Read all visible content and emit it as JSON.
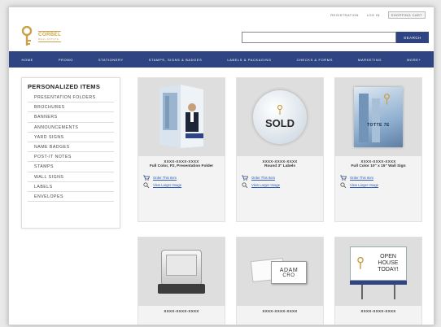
{
  "header": {
    "links": [
      "REGISTRATION",
      "LOG IN",
      "SHOPPING CART"
    ],
    "brand": "CORBEL",
    "brand_sub": "REAL ESTATE",
    "search": {
      "placeholder": "",
      "button": "SEARCH"
    }
  },
  "nav": [
    "HOME",
    "PROMO",
    "STATIONERY",
    "STAMPS, SIGNS & BADGES",
    "LABELS & PACKAGING",
    "CHECKS & FORMS",
    "MARKETING",
    "MORE+"
  ],
  "sidebar": {
    "title": "PERSONALIZED ITEMS",
    "items": [
      "PRESENTATION FOLDERS",
      "BROCHURES",
      "BANNERS",
      "ANNOUNCEMENTS",
      "YARD SIGNS",
      "NAME BADGES",
      "POST-IT NOTES",
      "STAMPS",
      "WALL SIGNS",
      "LABELS",
      "ENVELOPES"
    ]
  },
  "products": [
    {
      "sku": "XXXX-XXXX-XXXX",
      "name": "Full Color, P2, Presentation Folder",
      "order": "Order This Item",
      "view": "View Larger Image"
    },
    {
      "sku": "XXXX-XXXX-XXXX",
      "name": "Round 3\" Labels",
      "order": "Order This Item",
      "view": "View Larger Image",
      "label_text": "SOLD"
    },
    {
      "sku": "XXXX-XXXX-XXXX",
      "name": "Full Color 10\" x 15\" Wall Sign",
      "order": "Order This Item",
      "view": "View Larger Image",
      "sign_text": "TOTTE 7E"
    },
    {
      "sku": "XXXX-XXXX-XXXX"
    },
    {
      "sku": "XXXX-XXXX-XXXX",
      "badge_name": "ADAM",
      "badge_title": "CRO"
    },
    {
      "sku": "XXXX-XXXX-XXXX",
      "sign_lines": [
        "OPEN",
        "HOUSE",
        "TODAY!"
      ]
    }
  ],
  "colors": {
    "nav_bg": "#2f4583",
    "brand_gold": "#c9a24a",
    "link": "#2e5fb5"
  }
}
